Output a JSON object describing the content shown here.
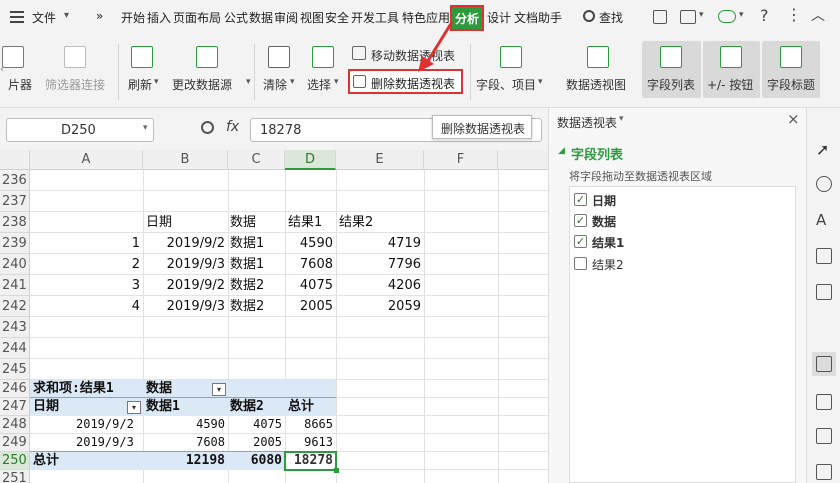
{
  "menubar": {
    "file": "文件",
    "more": "»",
    "tabs": [
      "开始",
      "插入",
      "页面布局",
      "公式",
      "数据",
      "审阅",
      "视图",
      "安全",
      "开发工具",
      "特色应用",
      "分析",
      "设计",
      "文档助手"
    ],
    "active_tab": "分析",
    "search": "查找"
  },
  "ribbon": {
    "slicer": "片器",
    "filter_conn": "筛选器连接",
    "refresh": "刷新",
    "change_source": "更改数据源",
    "clear": "清除",
    "select": "选择",
    "move_pivot": "移动数据透视表",
    "delete_pivot": "删除数据透视表",
    "field_items": "字段、项目",
    "pivot_chart": "数据透视图",
    "field_list": "字段列表",
    "plus_minus": "+/- 按钮",
    "field_header": "字段标题"
  },
  "tooltip": "删除数据透视表",
  "formula_bar": {
    "name_box": "D250",
    "fx": "fx",
    "value": "18278"
  },
  "columns": [
    "A",
    "B",
    "C",
    "D",
    "E",
    "F"
  ],
  "rows": [
    "236",
    "237",
    "238",
    "239",
    "240",
    "241",
    "242",
    "243",
    "244",
    "245",
    "246",
    "247",
    "248",
    "249",
    "250",
    "251"
  ],
  "source_table": {
    "headers": [
      "日期",
      "数据",
      "结果1",
      "结果2"
    ],
    "rows": [
      {
        "idx": "1",
        "date": "2019/9/2",
        "data": "数据1",
        "r1": "4590",
        "r2": "4719"
      },
      {
        "idx": "2",
        "date": "2019/9/3",
        "data": "数据1",
        "r1": "7608",
        "r2": "7796"
      },
      {
        "idx": "3",
        "date": "2019/9/2",
        "data": "数据2",
        "r1": "4075",
        "r2": "4206"
      },
      {
        "idx": "4",
        "date": "2019/9/3",
        "data": "数据2",
        "r1": "2005",
        "r2": "2059"
      }
    ]
  },
  "pivot": {
    "sum_label": "求和项:结果1",
    "data_label": "数据",
    "date_label": "日期",
    "col1": "数据1",
    "col2": "数据2",
    "total_label": "总计",
    "rows": [
      {
        "date": "2019/9/2",
        "v1": "4590",
        "v2": "4075",
        "t": "8665"
      },
      {
        "date": "2019/9/3",
        "v1": "7608",
        "v2": "2005",
        "t": "9613"
      }
    ],
    "grand": {
      "label": "总计",
      "v1": "12198",
      "v2": "6080",
      "t": "18278"
    }
  },
  "pane": {
    "title": "数据透视表",
    "section": "字段列表",
    "hint": "将字段拖动至数据透视表区域",
    "fields": [
      {
        "name": "日期",
        "checked": true
      },
      {
        "name": "数据",
        "checked": true
      },
      {
        "name": "结果1",
        "checked": true
      },
      {
        "name": "结果2",
        "checked": false
      }
    ]
  },
  "colors": {
    "accent": "#2e9a3e",
    "highlight": "#e03030",
    "pivot_header": "#dbe8f5"
  }
}
